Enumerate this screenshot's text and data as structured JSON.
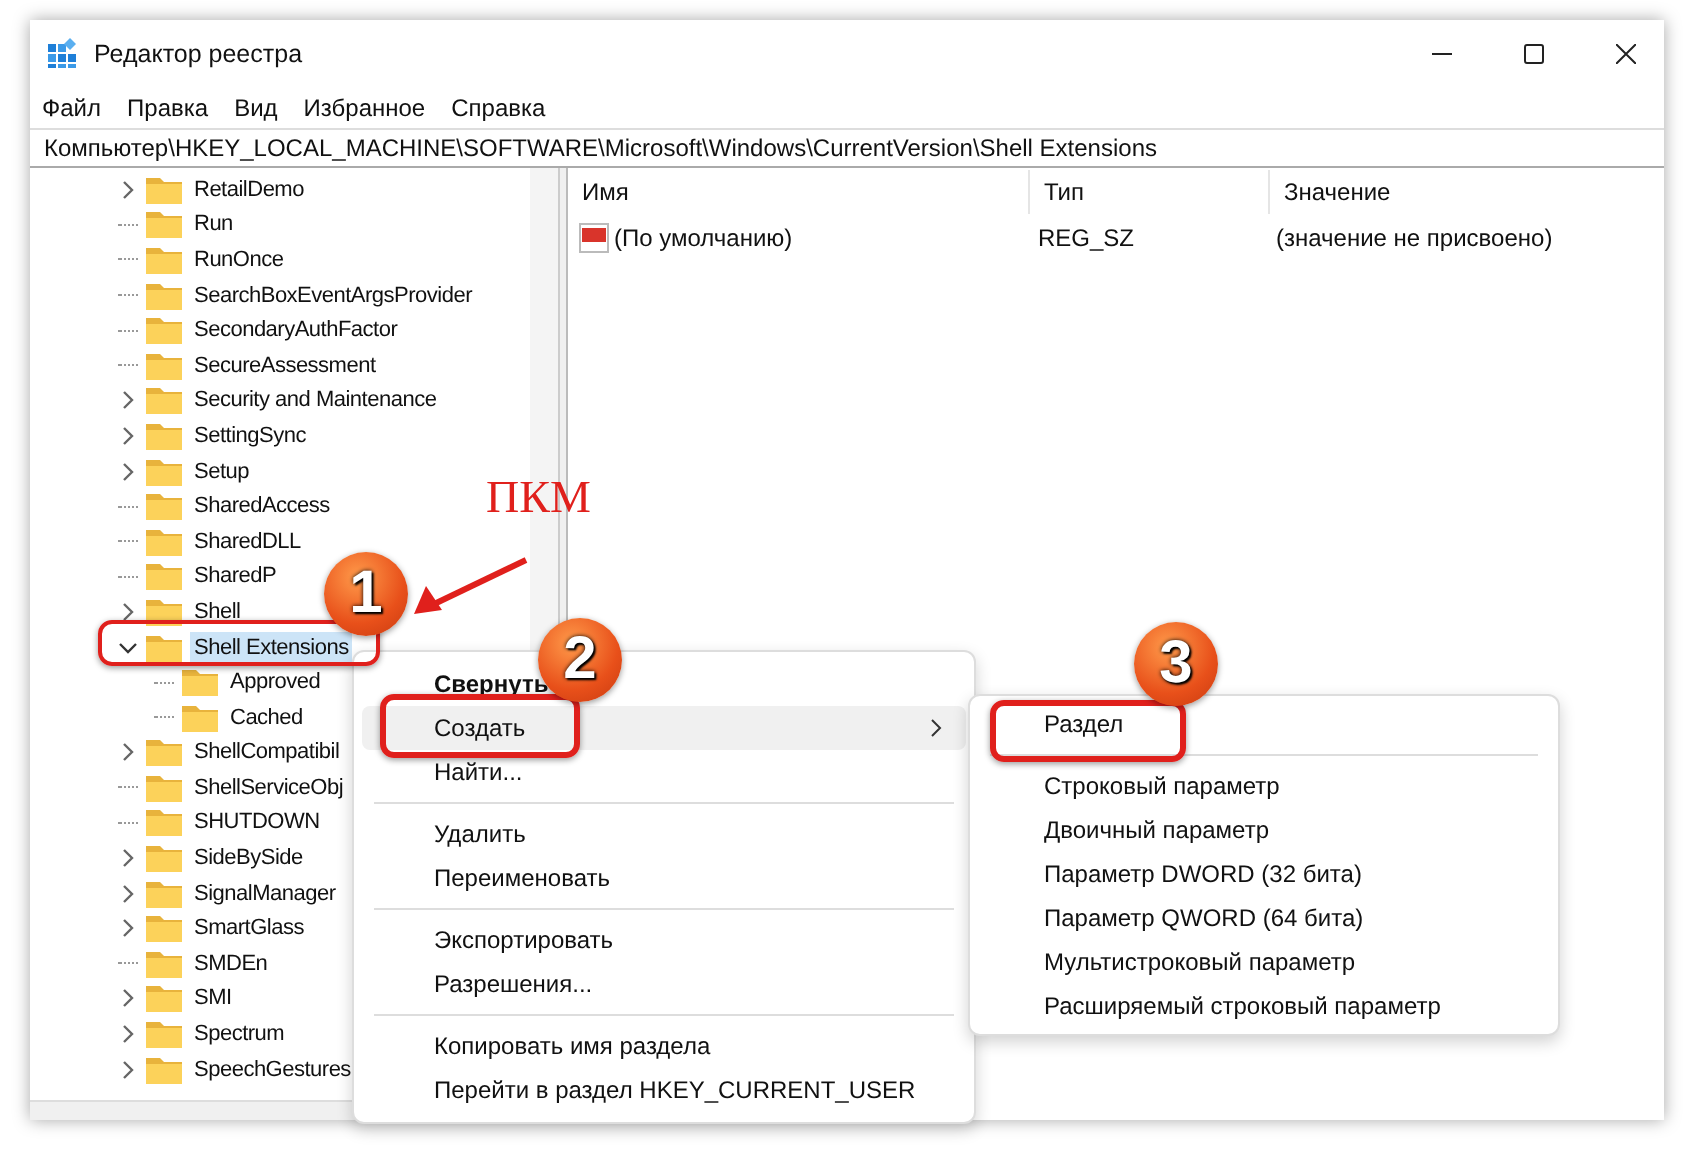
{
  "window": {
    "title": "Редактор реестра"
  },
  "menu": [
    "Файл",
    "Правка",
    "Вид",
    "Избранное",
    "Справка"
  ],
  "address": "Компьютер\\HKEY_LOCAL_MACHINE\\SOFTWARE\\Microsoft\\Windows\\CurrentVersion\\Shell Extensions",
  "tree": [
    {
      "label": "RetailDemo",
      "kind": "collapsed",
      "selected": false
    },
    {
      "label": "Run",
      "kind": "leaf",
      "selected": false
    },
    {
      "label": "RunOnce",
      "kind": "leaf",
      "selected": false
    },
    {
      "label": "SearchBoxEventArgsProvider",
      "kind": "leaf",
      "selected": false
    },
    {
      "label": "SecondaryAuthFactor",
      "kind": "leaf",
      "selected": false
    },
    {
      "label": "SecureAssessment",
      "kind": "leaf",
      "selected": false
    },
    {
      "label": "Security and Maintenance",
      "kind": "collapsed",
      "selected": false
    },
    {
      "label": "SettingSync",
      "kind": "collapsed",
      "selected": false
    },
    {
      "label": "Setup",
      "kind": "collapsed",
      "selected": false
    },
    {
      "label": "SharedAccess",
      "kind": "leaf",
      "selected": false
    },
    {
      "label": "SharedDLL",
      "kind": "leaf",
      "selected": false
    },
    {
      "label": "SharedP",
      "kind": "leaf",
      "selected": false
    },
    {
      "label": "Shell",
      "kind": "collapsed",
      "selected": false
    },
    {
      "label": "Shell Extensions",
      "kind": "expanded",
      "selected": true,
      "children": [
        {
          "label": "Approved",
          "kind": "leaf",
          "selected": false
        },
        {
          "label": "Cached",
          "kind": "leaf",
          "selected": false
        }
      ]
    },
    {
      "label": "ShellCompatibil",
      "kind": "collapsed",
      "selected": false
    },
    {
      "label": "ShellServiceObj",
      "kind": "leaf",
      "selected": false
    },
    {
      "label": "SHUTDOWN",
      "kind": "leaf",
      "selected": false
    },
    {
      "label": "SideBySide",
      "kind": "collapsed",
      "selected": false
    },
    {
      "label": "SignalManager",
      "kind": "collapsed",
      "selected": false
    },
    {
      "label": "SmartGlass",
      "kind": "collapsed",
      "selected": false
    },
    {
      "label": "SMDEn",
      "kind": "leaf",
      "selected": false
    },
    {
      "label": "SMI",
      "kind": "collapsed",
      "selected": false
    },
    {
      "label": "Spectrum",
      "kind": "collapsed",
      "selected": false
    },
    {
      "label": "SpeechGestures",
      "kind": "collapsed",
      "selected": false
    }
  ],
  "table": {
    "columns": [
      "Имя",
      "Тип",
      "Значение"
    ],
    "rows": [
      {
        "name": "(По умолчанию)",
        "type": "REG_SZ",
        "data": "(значение не присвоено)"
      }
    ]
  },
  "context_menu": [
    {
      "kind": "item",
      "label": "Свернуть",
      "bold": true,
      "selected": false,
      "submenu": false
    },
    {
      "kind": "item",
      "label": "Создать",
      "bold": false,
      "selected": true,
      "submenu": true
    },
    {
      "kind": "item",
      "label": "Найти...",
      "bold": false,
      "selected": false,
      "submenu": false
    },
    {
      "kind": "separator"
    },
    {
      "kind": "item",
      "label": "Удалить",
      "bold": false,
      "selected": false,
      "submenu": false
    },
    {
      "kind": "item",
      "label": "Переименовать",
      "bold": false,
      "selected": false,
      "submenu": false
    },
    {
      "kind": "separator"
    },
    {
      "kind": "item",
      "label": "Экспортировать",
      "bold": false,
      "selected": false,
      "submenu": false
    },
    {
      "kind": "item",
      "label": "Разрешения...",
      "bold": false,
      "selected": false,
      "submenu": false
    },
    {
      "kind": "separator"
    },
    {
      "kind": "item",
      "label": "Копировать имя раздела",
      "bold": false,
      "selected": false,
      "submenu": false
    },
    {
      "kind": "item",
      "label": "Перейти в раздел HKEY_CURRENT_USER",
      "bold": false,
      "selected": false,
      "submenu": false
    }
  ],
  "submenu": [
    {
      "kind": "item",
      "label": "Раздел"
    },
    {
      "kind": "separator"
    },
    {
      "kind": "item",
      "label": "Строковый параметр"
    },
    {
      "kind": "item",
      "label": "Двоичный параметр"
    },
    {
      "kind": "item",
      "label": "Параметр DWORD (32 бита)"
    },
    {
      "kind": "item",
      "label": "Параметр QWORD (64 бита)"
    },
    {
      "kind": "item",
      "label": "Мультистроковый параметр"
    },
    {
      "kind": "item",
      "label": "Расширяемый строковый параметр"
    }
  ],
  "annotations": {
    "label": "ПКМ",
    "badges": [
      "1",
      "2",
      "3"
    ]
  }
}
